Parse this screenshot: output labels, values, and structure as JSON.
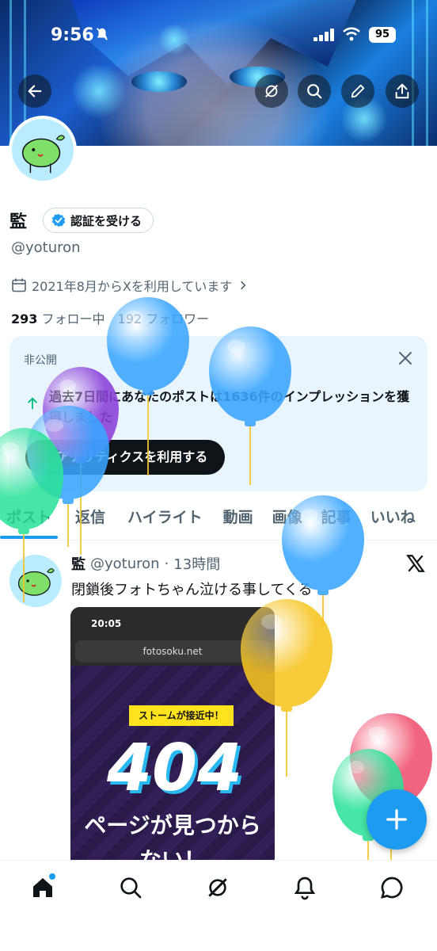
{
  "status_bar": {
    "time": "9:56",
    "battery": "95"
  },
  "profile": {
    "name": "監",
    "verify_label": "認証を受ける",
    "handle": "@yoturon",
    "joined": "2021年8月からXを利用しています",
    "following_count": "293",
    "following_label": "フォロー中",
    "followers_count": "192",
    "followers_label": "フォロワー"
  },
  "private_card": {
    "title": "非公開",
    "message": "過去7日間にあなたのポストは1636件のインプレッションを獲得しました",
    "button": "アナリティクスを利用する"
  },
  "tabs": [
    {
      "label": "ポスト",
      "active": true
    },
    {
      "label": "返信"
    },
    {
      "label": "ハイライト"
    },
    {
      "label": "動画"
    },
    {
      "label": "画像"
    },
    {
      "label": "記事"
    },
    {
      "label": "いいね"
    }
  ],
  "post": {
    "name": "監",
    "handle": "@yoturon",
    "separator": "·",
    "time": "13時間",
    "text": "閉鎖後フォトちゃん泣ける事してくる",
    "image": {
      "time": "20:05",
      "url": "fotosoku.net",
      "warning": "ストームが接近中！",
      "code": "404",
      "subtitle": "ページが見つから ない！"
    }
  },
  "icons": {
    "back": "back-arrow-icon",
    "grok": "grok-icon",
    "search": "search-icon",
    "edit": "pencil-icon",
    "share": "share-icon",
    "calendar": "calendar-icon",
    "verified": "verified-badge-icon",
    "close": "close-icon",
    "x": "x-logo-icon",
    "fab": "plus-icon"
  },
  "colors": {
    "accent": "#1d9bf0",
    "card_bg": "#e8f5fd"
  },
  "balloon_colors": [
    "#3aa6ff",
    "#3aa6ff",
    "#8a3fd8",
    "#3aa6ff",
    "#2ee29a",
    "#3aa6ff",
    "#f6c41f",
    "#f0506e",
    "#2ee29a"
  ]
}
